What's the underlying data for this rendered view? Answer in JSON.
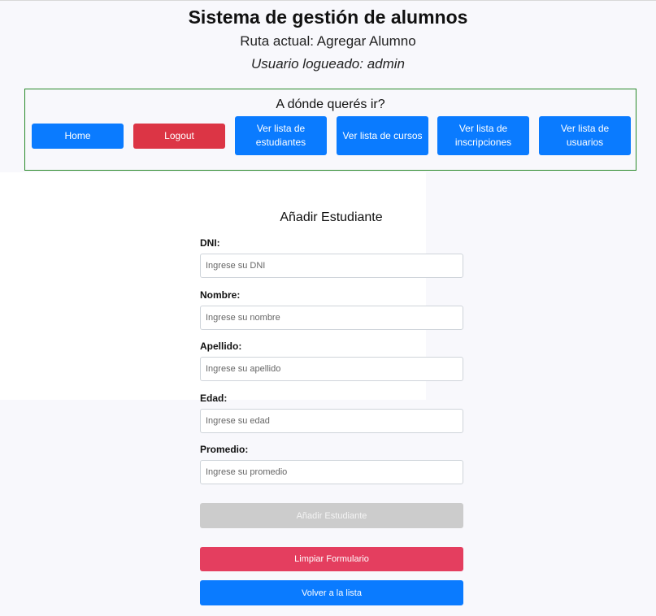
{
  "header": {
    "title": "Sistema de gestión de alumnos",
    "route": "Ruta actual: Agregar Alumno",
    "user": "Usuario logueado: admin"
  },
  "nav": {
    "title": "A dónde querés ir?",
    "buttons": [
      {
        "label": "Home",
        "color": "#0a7bff"
      },
      {
        "label": "Logout",
        "color": "#dc3545"
      },
      {
        "label": "Ver lista de estudiantes",
        "color": "#0a7bff"
      },
      {
        "label": "Ver lista de cursos",
        "color": "#0a7bff"
      },
      {
        "label": "Ver lista de inscripciones",
        "color": "#0a7bff"
      },
      {
        "label": "Ver lista de usuarios",
        "color": "#0a7bff"
      }
    ]
  },
  "form": {
    "title": "Añadir Estudiante",
    "fields": [
      {
        "label": "DNI:",
        "placeholder": "Ingrese su DNI",
        "value": ""
      },
      {
        "label": "Nombre:",
        "placeholder": "Ingrese su nombre",
        "value": ""
      },
      {
        "label": "Apellido:",
        "placeholder": "Ingrese su apellido",
        "value": ""
      },
      {
        "label": "Edad:",
        "placeholder": "Ingrese su edad",
        "value": ""
      },
      {
        "label": "Promedio:",
        "placeholder": "Ingrese su promedio",
        "value": ""
      }
    ],
    "submit_label": "Añadir Estudiante",
    "submit_disabled": true,
    "clear_label": "Limpiar Formulario",
    "back_label": "Volver a la lista"
  },
  "colors": {
    "primary": "#0a7bff",
    "danger": "#dc3545",
    "clear": "#e43e5f",
    "disabled": "#cccccc",
    "nav_border": "#2a8a2a"
  }
}
